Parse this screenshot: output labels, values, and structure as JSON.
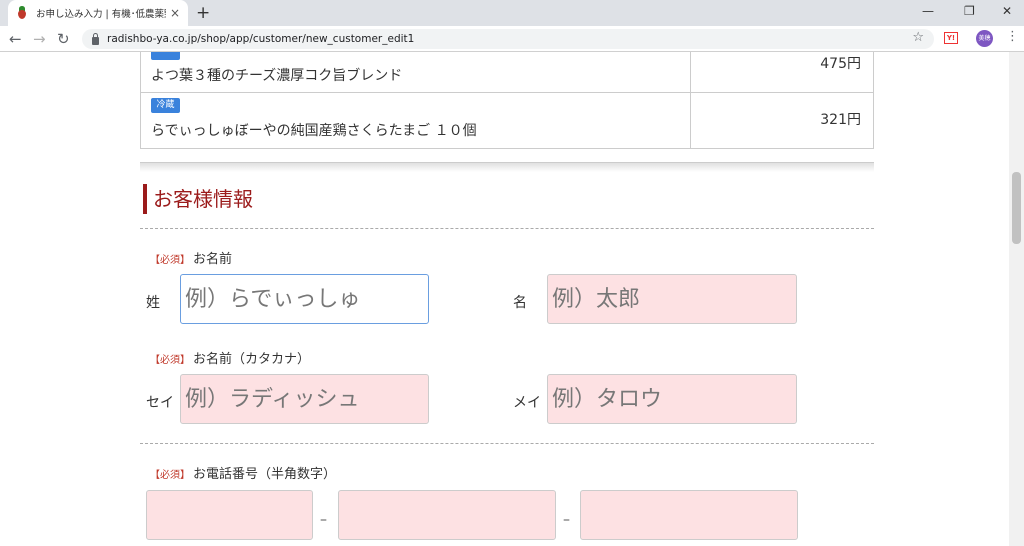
{
  "browser": {
    "tab_title": "お申し込み入力 | 有機･低農薬野菜",
    "tab_close": "×",
    "new_tab": "+",
    "url": "radishbo-ya.co.jp/shop/app/customer/new_customer_edit1",
    "avatar_text": "美穂",
    "ext_label": "Y!"
  },
  "cart": {
    "items": [
      {
        "badge": "",
        "name": "よつ葉３種のチーズ濃厚コク旨ブレンド",
        "price": "475円"
      },
      {
        "badge": "冷蔵",
        "name": "らでぃっしゅぼーやの純国産鶏さくらたまご １０個",
        "price": "321円"
      }
    ]
  },
  "section": {
    "title": "お客様情報"
  },
  "form": {
    "required": "【必須】",
    "name": {
      "label": "お名前",
      "last_label": "姓",
      "last_placeholder": "例）らでぃっしゅ",
      "first_label": "名",
      "first_placeholder": "例）太郎"
    },
    "kana": {
      "label": "お名前（カタカナ）",
      "last_label": "セイ",
      "last_placeholder": "例）ラディッシュ",
      "first_label": "メイ",
      "first_placeholder": "例）タロウ"
    },
    "phone": {
      "label": "お電話番号（半角数字）",
      "separator": "–"
    }
  }
}
